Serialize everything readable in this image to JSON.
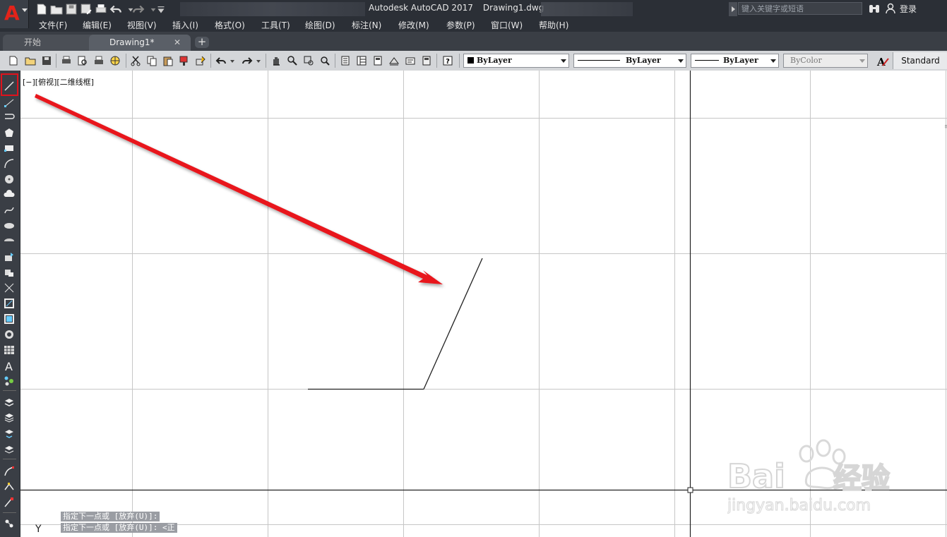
{
  "window": {
    "app_name": "Autodesk AutoCAD 2017",
    "file_name": "Drawing1.dwg",
    "search_placeholder": "键入关键字或短语",
    "login_label": "登录"
  },
  "menu": [
    "文件(F)",
    "编辑(E)",
    "视图(V)",
    "插入(I)",
    "格式(O)",
    "工具(T)",
    "绘图(D)",
    "标注(N)",
    "修改(M)",
    "参数(P)",
    "窗口(W)",
    "帮助(H)"
  ],
  "tabs": [
    {
      "label": "开始",
      "active": false
    },
    {
      "label": "Drawing1*",
      "active": true
    }
  ],
  "toolbar": {
    "color_combo": "ByLayer",
    "linetype_combo": "ByLayer",
    "lineweight_combo": "ByLayer",
    "plotstyle_combo": "ByColor",
    "text_style": "Standard"
  },
  "viewport": {
    "label": "[−][俯视][二维线框]"
  },
  "command_history": [
    "指定下一点或 [放弃(U)]:",
    "指定下一点或 [放弃(U)]:  <正"
  ],
  "ucs_label": "Y",
  "colors": {
    "accent": "#e2231a",
    "highlight_box": "#e0121c",
    "annotation_arrow": "#e8141c",
    "dark_chrome": "#2b2f36",
    "grid": "#c8c8c8"
  },
  "drawing": {
    "entities": [
      "horizontal-line-segment",
      "angled-line-segment"
    ],
    "highlighted_tool": "line-tool"
  }
}
